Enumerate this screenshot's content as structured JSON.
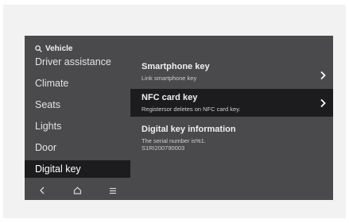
{
  "header": {
    "search_label": "Vehicle",
    "search_icon": "search-icon"
  },
  "sidebar": {
    "items": [
      {
        "label": "Driver assistance"
      },
      {
        "label": "Climate"
      },
      {
        "label": "Seats"
      },
      {
        "label": "Lights"
      },
      {
        "label": "Door"
      },
      {
        "label": "Digital key",
        "active": true
      }
    ]
  },
  "bottom_bar": {
    "icons": [
      "back-icon",
      "home-icon",
      "menu-icon"
    ]
  },
  "content": {
    "entries": [
      {
        "title": "Smartphone key",
        "subtitle": "Link smartphone key",
        "chevron": true
      },
      {
        "title": "NFC card key",
        "subtitle": "Registersor deletes on NFC card key.",
        "chevron": true,
        "selected": true
      },
      {
        "title": "Digital key information",
        "subtitle_line1": "The serial number is%1.",
        "subtitle_line2": "S1RI200790003"
      }
    ]
  },
  "colors": {
    "screen_bg": "#4a4a4c",
    "selected_bg": "#1c1c1e",
    "text": "#f0f0f0"
  }
}
